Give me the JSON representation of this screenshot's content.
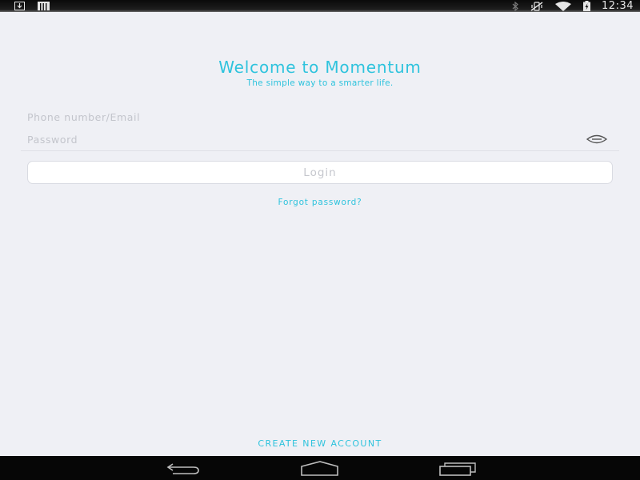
{
  "status_bar": {
    "time": "12:34",
    "left_icons": [
      "download-icon",
      "sd-card-icon"
    ],
    "right_icons": [
      "bluetooth-icon",
      "vibrate-icon",
      "wifi-icon",
      "battery-charging-icon"
    ]
  },
  "login": {
    "title": "Welcome to Momentum",
    "subtitle": "The simple way to a smarter life.",
    "phone_field": {
      "placeholder": "Phone number/Email",
      "value": ""
    },
    "password_field": {
      "placeholder": "Password",
      "value": ""
    },
    "login_label": "Login",
    "forgot_label": "Forgot password?",
    "create_label": "CREATE NEW ACCOUNT"
  },
  "nav_bar": {
    "buttons": [
      "back-icon",
      "home-icon",
      "recents-icon"
    ]
  },
  "colors": {
    "accent": "#2ec3dd",
    "background": "#eff0f5",
    "status_bar": "#111111",
    "nav_bar": "#060606",
    "placeholder": "#c3c5cc"
  }
}
